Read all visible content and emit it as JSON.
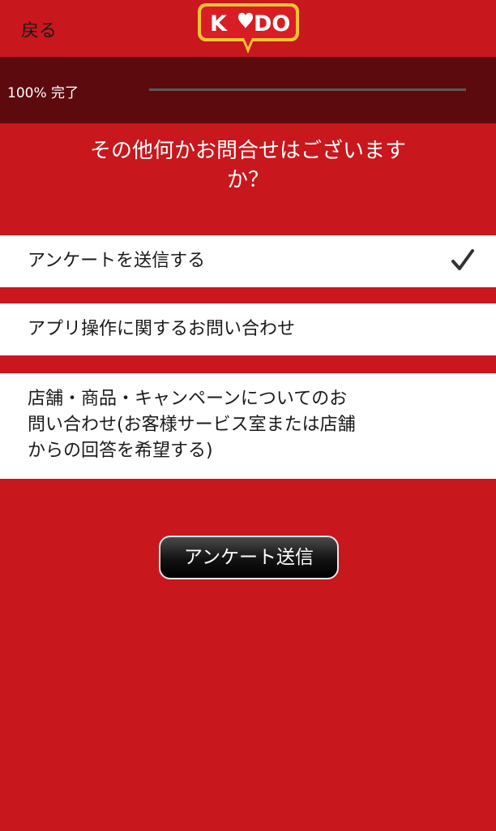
{
  "header": {
    "back_label": "戻る",
    "logo_text": "KODO"
  },
  "progress": {
    "label": "100% 完了",
    "value": 1.0
  },
  "question": {
    "line1": "その他何かお問合せはございます",
    "line2": "か？"
  },
  "options": [
    {
      "label": "アンケートを送信する",
      "selected": true
    },
    {
      "label": "アプリ操作に関するお問い合わせ",
      "selected": false
    },
    {
      "lines": [
        "店舗・商品・キャンペーンについてのお",
        "問い合わせ(お客様サービス室または店舗",
        "からの回答を希望する)"
      ],
      "selected": false
    }
  ],
  "submit": {
    "label": "アンケート送信"
  },
  "colors": {
    "background": "#c8171d",
    "progress_band": "#5d0a0f",
    "logo_yellow": "#f6c233",
    "logo_red": "#d81e24"
  }
}
